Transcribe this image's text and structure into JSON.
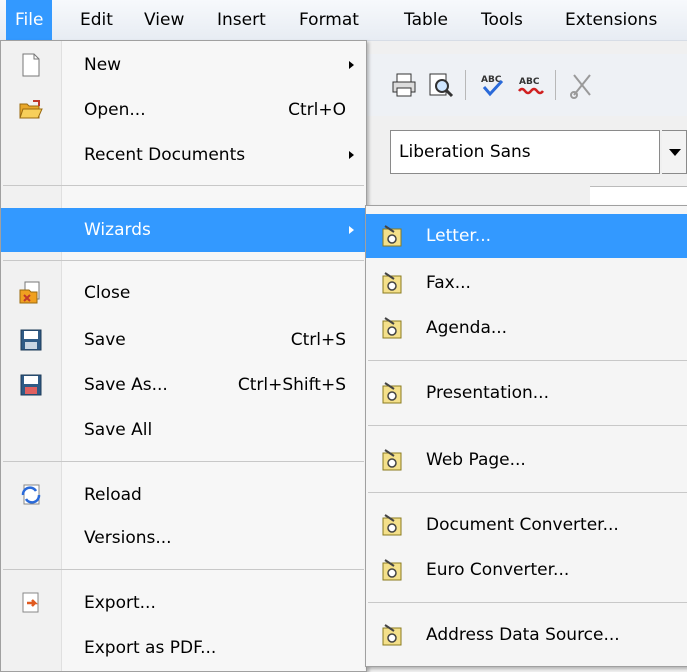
{
  "menubar": {
    "file": "File",
    "edit": "Edit",
    "view": "View",
    "insert": "Insert",
    "format": "Format",
    "table": "Table",
    "tools": "Tools",
    "extensions": "Extensions"
  },
  "toolbar": {
    "font_name": "Liberation Sans"
  },
  "file_menu": {
    "new": "New",
    "open": "Open...",
    "open_shortcut": "Ctrl+O",
    "recent": "Recent Documents",
    "wizards": "Wizards",
    "close": "Close",
    "save": "Save",
    "save_shortcut": "Ctrl+S",
    "save_as": "Save As...",
    "save_as_shortcut": "Ctrl+Shift+S",
    "save_all": "Save All",
    "reload": "Reload",
    "versions": "Versions...",
    "export": "Export...",
    "export_pdf": "Export as PDF..."
  },
  "wizards_menu": {
    "letter": "Letter...",
    "fax": "Fax...",
    "agenda": "Agenda...",
    "presentation": "Presentation...",
    "web_page": "Web Page...",
    "doc_converter": "Document Converter...",
    "euro_converter": "Euro Converter...",
    "address_source": "Address Data Source..."
  },
  "colors": {
    "highlight": "#3399ff"
  }
}
